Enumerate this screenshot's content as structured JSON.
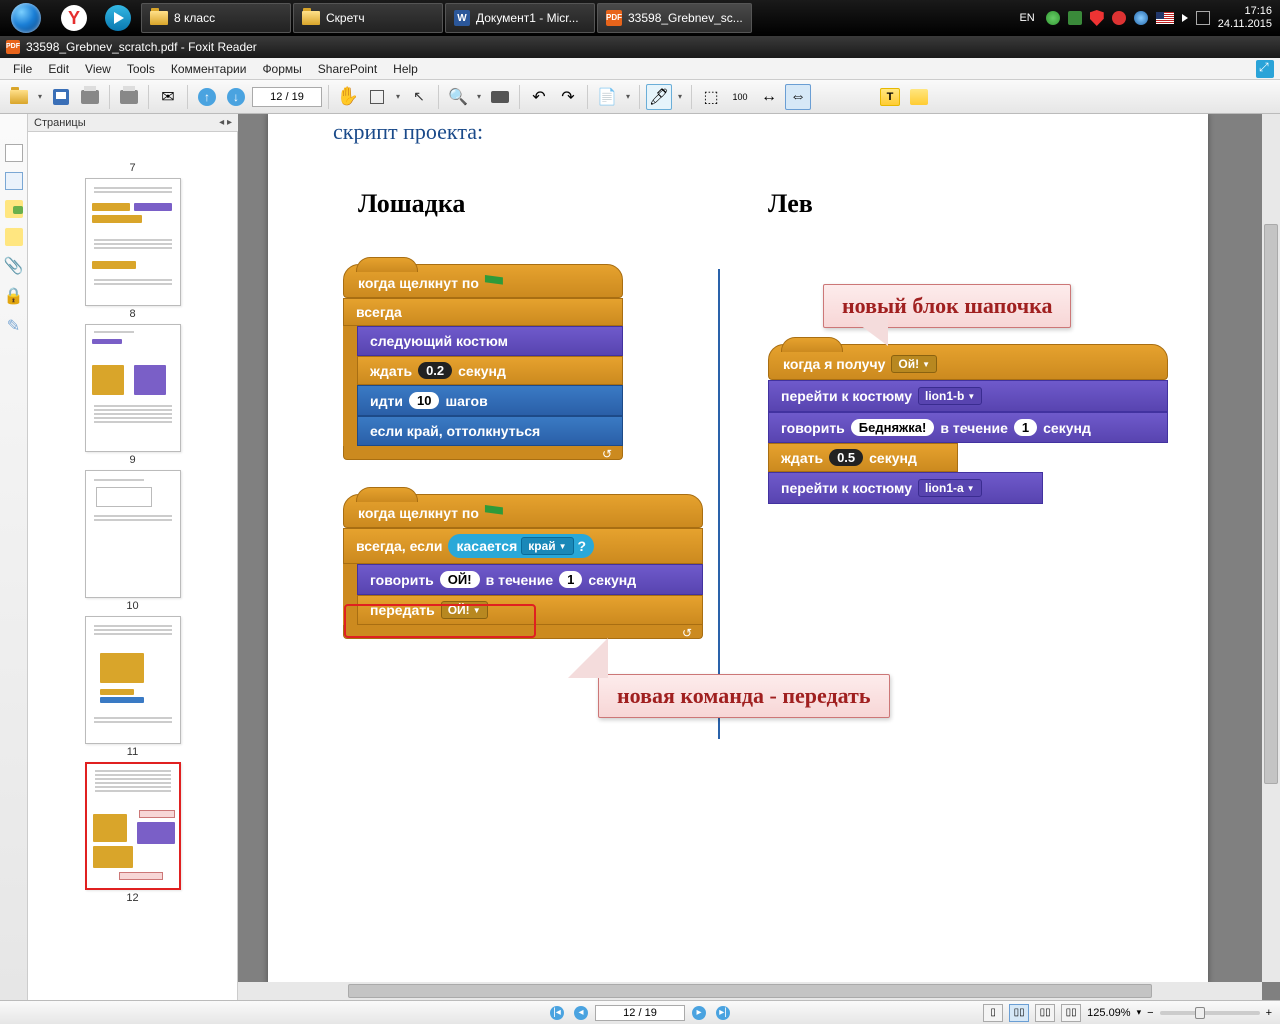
{
  "taskbar": {
    "tasks": [
      {
        "label": "8 класс"
      },
      {
        "label": "Скретч"
      },
      {
        "label": "Документ1 - Micr..."
      },
      {
        "label": "33598_Grebnev_sc..."
      }
    ],
    "lang": "EN",
    "time": "17:16",
    "date": "24.11.2015"
  },
  "app": {
    "title": "33598_Grebnev_scratch.pdf - Foxit Reader"
  },
  "menu": [
    "File",
    "Edit",
    "View",
    "Tools",
    "Комментарии",
    "Формы",
    "SharePoint",
    "Help"
  ],
  "toolbar": {
    "page_field": "12 / 19"
  },
  "side": {
    "panel_title": "Страницы",
    "thumbs": [
      {
        "n": "7",
        "short": true
      },
      {
        "n": "8"
      },
      {
        "n": "9"
      },
      {
        "n": "10"
      },
      {
        "n": "11"
      },
      {
        "n": "12",
        "sel": true
      }
    ]
  },
  "doc": {
    "title": "скрипт проекта:",
    "col1": "Лошадка",
    "col2": "Лев",
    "s1": {
      "hat": "когда щелкнут по",
      "forever": "всегда",
      "next_costume": "следующий костюм",
      "wait": "ждать",
      "wait_v": "0.2",
      "sec": "секунд",
      "move": "идти",
      "move_v": "10",
      "steps": "шагов",
      "bounce": "если край, оттолкнуться"
    },
    "s2": {
      "hat": "когда щелкнут по",
      "forever_if": "всегда, если",
      "touch": "касается",
      "edge": "край",
      "q": "?",
      "say": "говорить",
      "say_v": "ОЙ!",
      "say_mid": "в течение",
      "say_n": "1",
      "sec": "секунд",
      "broadcast": "передать",
      "bc_v": "ОЙ!"
    },
    "s3": {
      "hat": "когда я получу",
      "hat_v": "Ой!",
      "goto1": "перейти к костюму",
      "c1": "lion1-b",
      "say": "говорить",
      "say_v": "Бедняжка!",
      "say_mid": "в течение",
      "say_n": "1",
      "sec": "секунд",
      "wait": "ждать",
      "wait_v": "0.5",
      "wsec": "секунд",
      "goto2": "перейти к костюму",
      "c2": "lion1-a"
    },
    "callout1": "новый блок шапочка",
    "callout2": "новая команда - передать"
  },
  "status": {
    "page_field": "12 / 19",
    "zoom": "125.09%"
  }
}
